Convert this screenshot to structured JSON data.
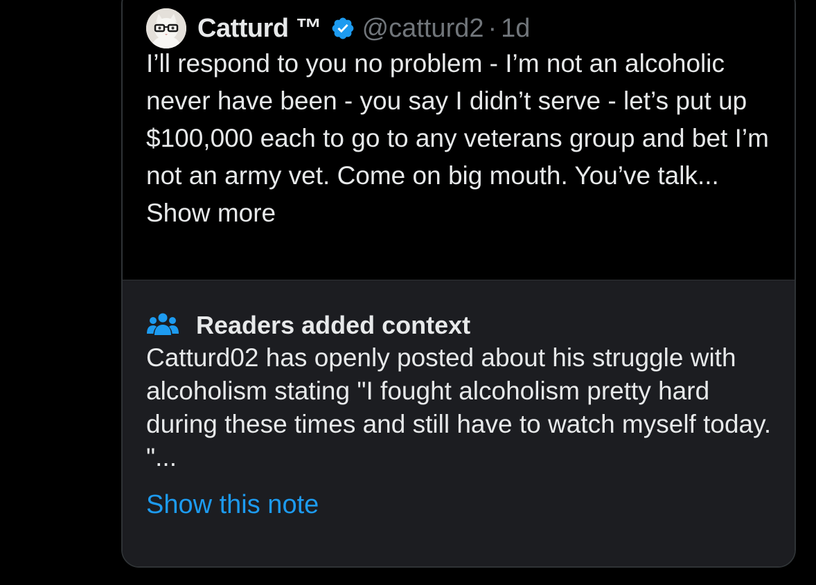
{
  "tweet": {
    "author_name": "Catturd",
    "trademark": "™",
    "handle": "@catturd2",
    "separator": "·",
    "time": "1d",
    "text": "I’ll respond to you no problem - I’m not an alcoholic never have been - you say I didn’t serve - let’s put up $100,000 each to go to any veterans group and bet I’m not an army vet. Come on big mouth. You’ve talk...",
    "show_more": "Show more"
  },
  "note": {
    "title": "Readers added context",
    "text": "Catturd02 has openly posted about his struggle with alcoholism stating \"I fought alcoholism pretty hard during these times and still have to watch myself today. \"...",
    "link": "Show this note"
  },
  "colors": {
    "background": "#000000",
    "note_background": "#1c1d21",
    "primary_text": "#e7e9ea",
    "secondary_text": "#71767b",
    "accent_blue": "#1d9bf0"
  },
  "icons": {
    "verified": "verified-badge-icon",
    "people": "people-icon",
    "avatar": "cat-avatar"
  }
}
